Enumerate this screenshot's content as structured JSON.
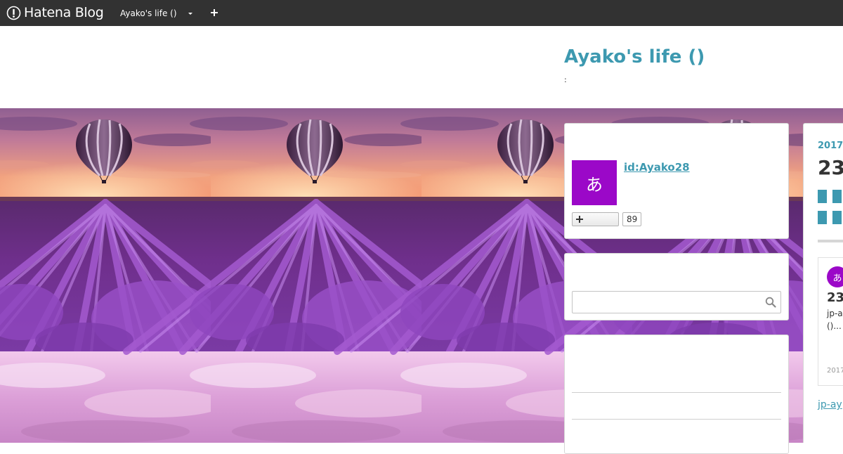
{
  "topbar": {
    "brand": "Hatena Blog",
    "blog_switcher_label": "Ayako's life ()",
    "icons": [
      "hatena-logo-icon",
      "caret-down-icon",
      "plus-icon"
    ]
  },
  "header": {
    "title": "Ayako's life ()",
    "description": ":"
  },
  "background_image": "lavender field with hot-air balloon at sunset, tiled",
  "sidebar": {
    "profile": {
      "avatar_glyph": "あ",
      "id": "id:Ayako28",
      "follow_count": "89"
    },
    "search": {
      "placeholder": "",
      "value": ""
    }
  },
  "main": {
    "archive_year": "2017",
    "archive_day": "23",
    "entry": {
      "avatar_glyph": "あ",
      "day": "23",
      "snippet_line1": "jp-a",
      "snippet_line2": "()...",
      "date": "2017"
    },
    "link": "jp-ay"
  },
  "colors": {
    "topbar": "#323232",
    "accent": "#3d99b0",
    "avatar": "#9b08c8"
  }
}
